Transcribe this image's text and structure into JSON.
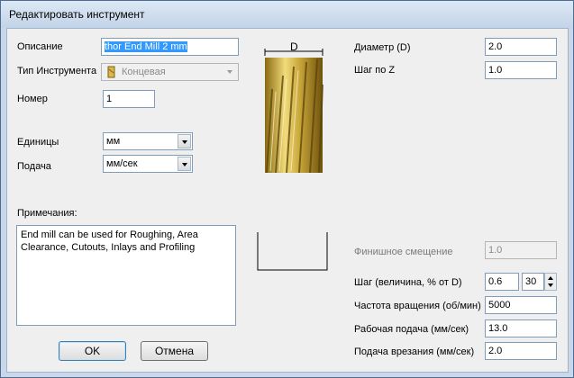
{
  "window": {
    "title": "Редактировать инструмент"
  },
  "form": {
    "description_label": "Описание",
    "description_value": "thor End Mill 2 mm",
    "tool_type_label": "Тип Инструмента",
    "tool_type_value": "Концевая",
    "number_label": "Номер",
    "number_value": "1",
    "units_label": "Единицы",
    "units_value": "мм",
    "feed_label": "Подача",
    "feed_value": "мм/сек",
    "notes_label": "Примечания:",
    "notes_value": "End mill can be used for Roughing, Area Clearance, Cutouts, Inlays and Profiling"
  },
  "preview": {
    "dimension_label": "D"
  },
  "params": {
    "diameter_label": "Диаметр (D)",
    "diameter_value": "2.0",
    "stepdown_label": "Шаг по Z",
    "stepdown_value": "1.0",
    "finish_allowance_label": "Финишное смещение",
    "finish_allowance_value": "1.0",
    "stepover_label": "Шаг (величина, % от D)",
    "stepover_value": "0.6",
    "stepover_percent": "30",
    "spindle_label": "Частота вращения (об/мин)",
    "spindle_value": "5000",
    "feed_rate_label": "Рабочая подача (мм/сек)",
    "feed_rate_value": "13.0",
    "plunge_label": "Подача врезания (мм/сек)",
    "plunge_value": "2.0"
  },
  "buttons": {
    "ok": "OK",
    "cancel": "Отмена"
  },
  "colors": {
    "tool_gold": "#c9a73a",
    "selection": "#3399ff"
  }
}
